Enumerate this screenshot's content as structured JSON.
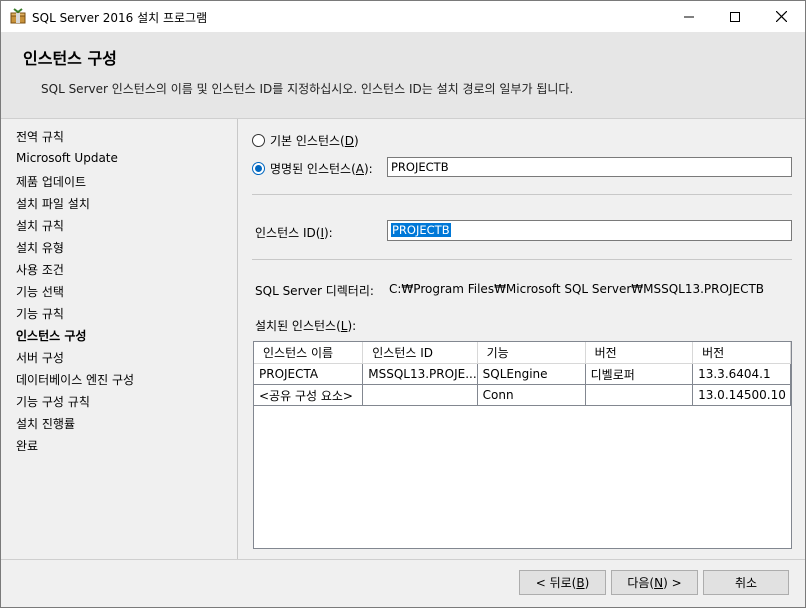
{
  "window": {
    "title": "SQL Server 2016 설치 프로그램",
    "controls": {
      "minimize": "—",
      "maximize": "☐",
      "close": "✕"
    }
  },
  "header": {
    "title": "인스턴스 구성",
    "subtitle": "SQL Server 인스턴스의 이름 및 인스턴스 ID를 지정하십시오. 인스턴스 ID는 설치 경로의 일부가 됩니다."
  },
  "sidebar": {
    "items": [
      {
        "label": "전역 규칙"
      },
      {
        "label": "Microsoft Update"
      },
      {
        "label": "제품 업데이트"
      },
      {
        "label": "설치 파일 설치"
      },
      {
        "label": "설치 규칙"
      },
      {
        "label": "설치 유형"
      },
      {
        "label": "사용 조건"
      },
      {
        "label": "기능 선택"
      },
      {
        "label": "기능 규칙"
      },
      {
        "label": "인스턴스 구성",
        "current": true
      },
      {
        "label": "서버 구성"
      },
      {
        "label": "데이터베이스 엔진 구성"
      },
      {
        "label": "기능 구성 규칙"
      },
      {
        "label": "설치 진행률"
      },
      {
        "label": "완료"
      }
    ]
  },
  "instance": {
    "default_label": "기본 인스턴스(",
    "default_key": "D",
    "named_label": "명명된 인스턴스(",
    "named_key": "A",
    "named_value": "PROJECTB",
    "selected": "named",
    "id_label": "인스턴스 ID(",
    "id_key": "I",
    "id_value": "PROJECTB",
    "dir_label": "SQL Server 디렉터리:",
    "dir_value": "C:₩Program Files₩Microsoft SQL Server₩MSSQL13.PROJECTB",
    "installed_label": "설치된 인스턴스(",
    "installed_key": "L"
  },
  "installed_table": {
    "columns": [
      "인스턴스 이름",
      "인스턴스 ID",
      "기능",
      "버전",
      "버전"
    ],
    "rows": [
      [
        "PROJECTA",
        "MSSQL13.PROJE...",
        "SQLEngine",
        "디벨로퍼",
        "13.3.6404.1"
      ],
      [
        "<공유 구성 요소>",
        "",
        "Conn",
        "",
        "13.0.14500.10"
      ]
    ]
  },
  "footer": {
    "back": "< 뒤로(",
    "back_key": "B",
    "back_end": ")",
    "next": "다음(",
    "next_key": "N",
    "next_end": ") >",
    "cancel": "취소"
  },
  "colors": {
    "accent": "#0067c0",
    "selection": "#0078d7",
    "header_bg": "#e6e6e6"
  }
}
